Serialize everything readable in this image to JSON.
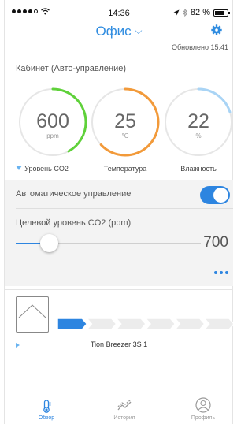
{
  "status_bar": {
    "time": "14:36",
    "battery": "82 %",
    "battery_level": 0.82
  },
  "nav": {
    "title": "Офис",
    "chevron": "chevron-down-icon",
    "settings_icon": "gear-icon"
  },
  "updated": "Обновлено 15:41",
  "room": {
    "title": "Кабинет (Авто-управление)"
  },
  "gauges": [
    {
      "value": "600",
      "unit": "ppm",
      "label": "Уровень CO2",
      "color": "#5fd13a",
      "fill": 0.42
    },
    {
      "value": "25",
      "unit": "°C",
      "label": "Температура",
      "color": "#f29a3a",
      "fill": 0.63
    },
    {
      "value": "22",
      "unit": "%",
      "label": "Влажность",
      "color": "#a9d4f5",
      "fill": 0.2
    }
  ],
  "controls": {
    "auto_label": "Автоматическое управление",
    "auto_on": true,
    "co2_target_label": "Целевой уровень CO2 (ppm)",
    "co2_target_value": "700",
    "slider_fraction": 0.18
  },
  "device": {
    "name": "Tion Breezer 3S 1",
    "speed_segments": 6,
    "active_speed": 1
  },
  "tabs": [
    {
      "label": "Обзор",
      "icon": "thermometer-icon",
      "active": true
    },
    {
      "label": "История",
      "icon": "chart-icon",
      "active": false
    },
    {
      "label": "Профиль",
      "icon": "profile-icon",
      "active": false
    }
  ],
  "colors": {
    "accent": "#2d85e0",
    "panel_bg": "#f3f3f3"
  }
}
